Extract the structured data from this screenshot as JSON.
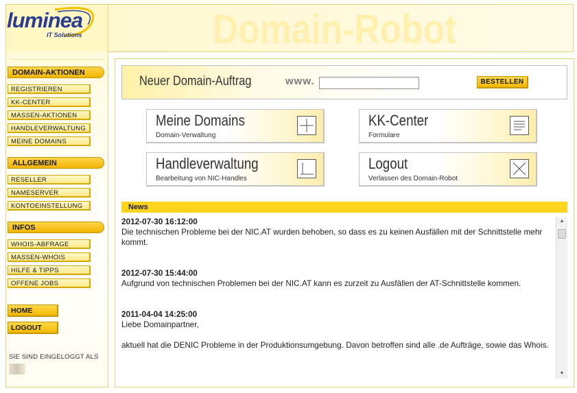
{
  "brand": {
    "logo_text": "luminea",
    "logo_tagline": "IT Solutions",
    "header_title": "Domain-Robot"
  },
  "sidebar": {
    "sections": [
      {
        "title": "DOMAIN-AKTIONEN",
        "items": [
          "REGISTRIEREN",
          "KK-CENTER",
          "MASSEN-AKTIONEN",
          "HANDLEVERWALTUNG",
          "MEINE DOMAINS"
        ]
      },
      {
        "title": "ALLGEMEIN",
        "items": [
          "RESELLER",
          "NAMESERVER",
          "KONTOEINSTELLUNG"
        ]
      },
      {
        "title": "INFOS",
        "items": [
          "WHOIS-ABFRAGE",
          "MASSEN-WHOIS",
          "HILFE & TIPPS",
          "OFFENE JOBS"
        ]
      }
    ],
    "home_label": "HOME",
    "logout_label": "LOGOUT",
    "logged_in_label": "SIE SIND EINGELOGGT ALS"
  },
  "order": {
    "title": "Neuer Domain-Auftrag",
    "prefix": "www.",
    "input_value": "",
    "button_label": "BESTELLEN"
  },
  "tiles": [
    {
      "title": "Meine Domains",
      "subtitle": "Domain-Verwaltung",
      "icon": "plus-grid-icon"
    },
    {
      "title": "KK-Center",
      "subtitle": "Formulare",
      "icon": "form-lines-icon"
    },
    {
      "title": "Handleverwaltung",
      "subtitle": "Bearbeitung von NIC-Handles",
      "icon": "corner-bracket-icon"
    },
    {
      "title": "Logout",
      "subtitle": "Verlassen des Domain-Robot",
      "icon": "close-x-icon"
    }
  ],
  "news": {
    "heading": "News",
    "items": [
      {
        "date": "2012-07-30 16:12:00",
        "text": "Die technischen Probleme bei der NIC.AT wurden behoben, so dass es zu keinen Ausfällen mit der Schnittstelle mehr kommt."
      },
      {
        "date": "2012-07-30 15:44:00",
        "text": "Aufgrund von technischen Problemen bei der NIC.AT kann es zurzeit zu Ausfällen der AT-Schnittstelle kommen."
      },
      {
        "date": "2011-04-04 14:25:00",
        "text": "Liebe Domainpartner,",
        "text2": "aktuell hat die DENIC Probleme in der Produktionsumgebung. Davon betroffen sind alle .de Aufträge, sowie das Whois."
      }
    ]
  },
  "colors": {
    "accent_yellow": "#ffd41c",
    "brand_blue": "#2a3d8f",
    "watermark": "#fff0b0"
  }
}
